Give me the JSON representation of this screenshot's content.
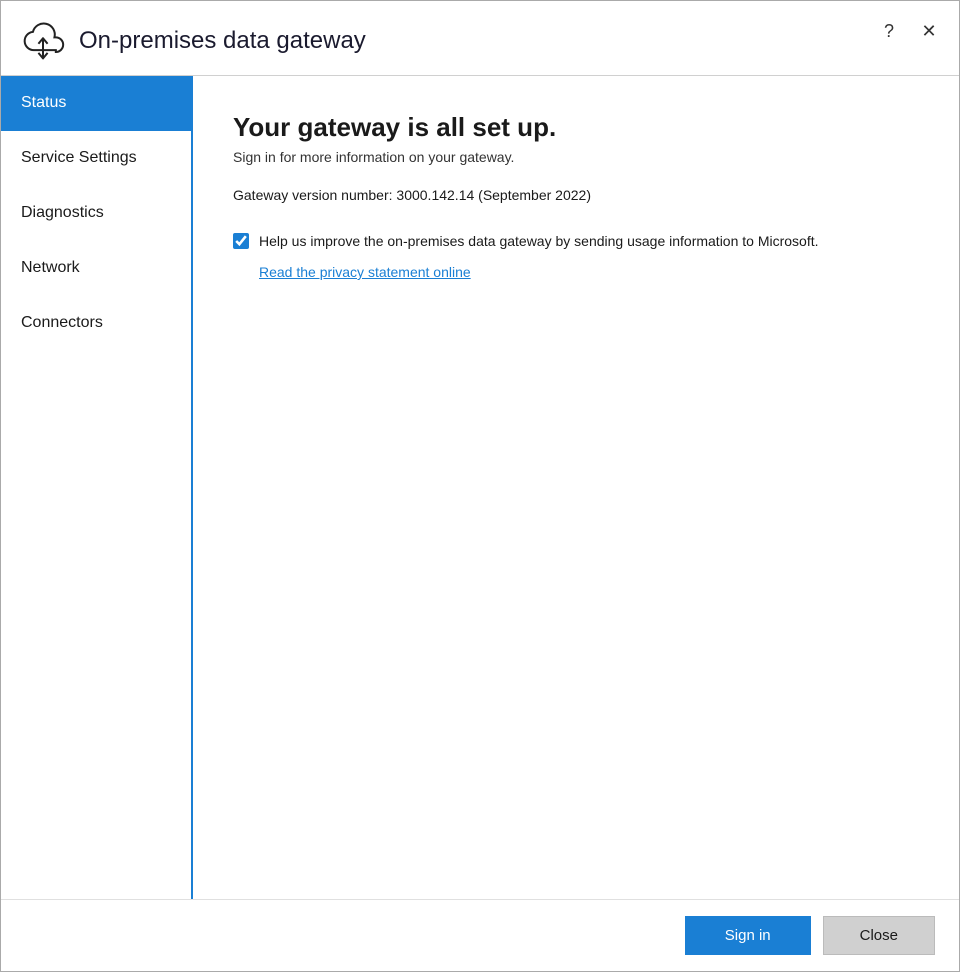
{
  "window": {
    "title": "On-premises data gateway",
    "controls": {
      "help_label": "?",
      "close_label": "✕"
    }
  },
  "sidebar": {
    "items": [
      {
        "id": "status",
        "label": "Status",
        "active": true
      },
      {
        "id": "service-settings",
        "label": "Service Settings",
        "active": false
      },
      {
        "id": "diagnostics",
        "label": "Diagnostics",
        "active": false
      },
      {
        "id": "network",
        "label": "Network",
        "active": false
      },
      {
        "id": "connectors",
        "label": "Connectors",
        "active": false
      }
    ]
  },
  "main": {
    "heading": "Your gateway is all set up.",
    "subtext": "Sign in for more information on your gateway.",
    "version_label": "Gateway version number: 3000.142.14 (September 2022)",
    "checkbox_label": "Help us improve the on-premises data gateway by sending usage information to Microsoft.",
    "privacy_link": "Read the privacy statement online",
    "checkbox_checked": true
  },
  "footer": {
    "signin_label": "Sign in",
    "close_label": "Close"
  },
  "colors": {
    "accent": "#1a7fd4",
    "active_sidebar_bg": "#1a7fd4",
    "active_sidebar_text": "#ffffff"
  }
}
